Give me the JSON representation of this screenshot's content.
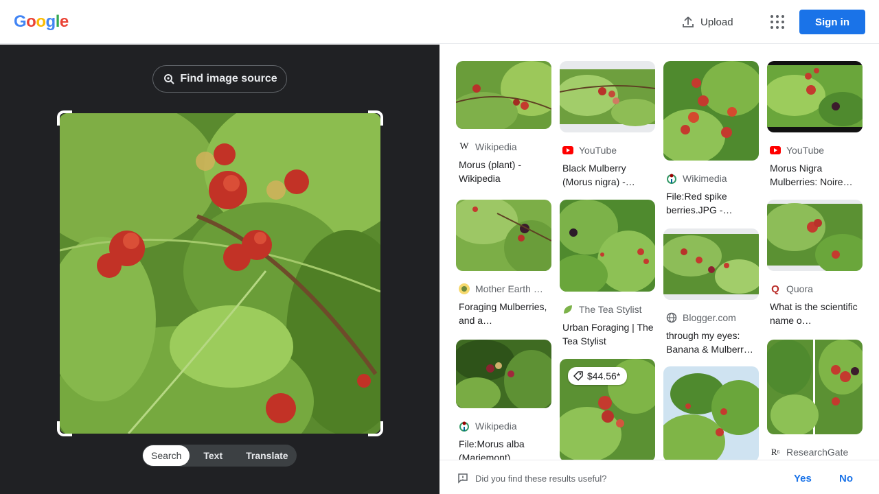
{
  "header": {
    "logo_letters": [
      "G",
      "o",
      "o",
      "g",
      "l",
      "e"
    ],
    "logo_colors": [
      "#4285f4",
      "#ea4335",
      "#fbbc05",
      "#4285f4",
      "#34a853",
      "#ea4335"
    ],
    "upload_label": "Upload",
    "signin_label": "Sign in"
  },
  "lens": {
    "find_source_label": "Find image source",
    "modes": [
      "Search",
      "Text",
      "Translate"
    ],
    "active_mode": "Search"
  },
  "results": [
    {
      "source": "Wikipedia",
      "source_icon": "wikipedia-icon",
      "title": "Morus (plant) - Wikipedia"
    },
    {
      "source": "YouTube",
      "source_icon": "youtube-icon",
      "title": "Black Mulberry (Morus nigra) -…"
    },
    {
      "source": "Wikimedia",
      "source_icon": "wikimedia-icon",
      "title": "File:Red spike berries.JPG -…"
    },
    {
      "source": "YouTube",
      "source_icon": "youtube-icon",
      "title": "Morus Nigra Mulberries: Noire…"
    },
    {
      "source": "Mother Earth …",
      "source_icon": "mother-earth-icon",
      "title": "Foraging Mulberries, and a…"
    },
    {
      "source": "The Tea Stylist",
      "source_icon": "leaf-icon",
      "title": "Urban Foraging | The Tea Stylist"
    },
    {
      "source": "Blogger.com",
      "source_icon": "globe-icon",
      "title": "through my eyes: Banana & Mulberr…"
    },
    {
      "source": "Quora",
      "source_icon": "quora-icon",
      "title": "What is the scientific name o…"
    },
    {
      "source": "Wikipedia",
      "source_icon": "wikimedia-icon",
      "title": "File:Morus alba (Mariemont)…"
    },
    {
      "source": "ResearchGate",
      "source_icon": "researchgate-icon",
      "title": ""
    },
    {
      "price": "$44.56*",
      "price_icon": "tag-icon"
    },
    {
      "source": "",
      "title": ""
    }
  ],
  "feedback": {
    "question": "Did you find these results useful?",
    "yes": "Yes",
    "no": "No"
  },
  "colors": {
    "accent": "#1a73e8",
    "dark_panel": "#202124",
    "youtube_red": "#ff0000",
    "quora_red": "#b92b27"
  }
}
